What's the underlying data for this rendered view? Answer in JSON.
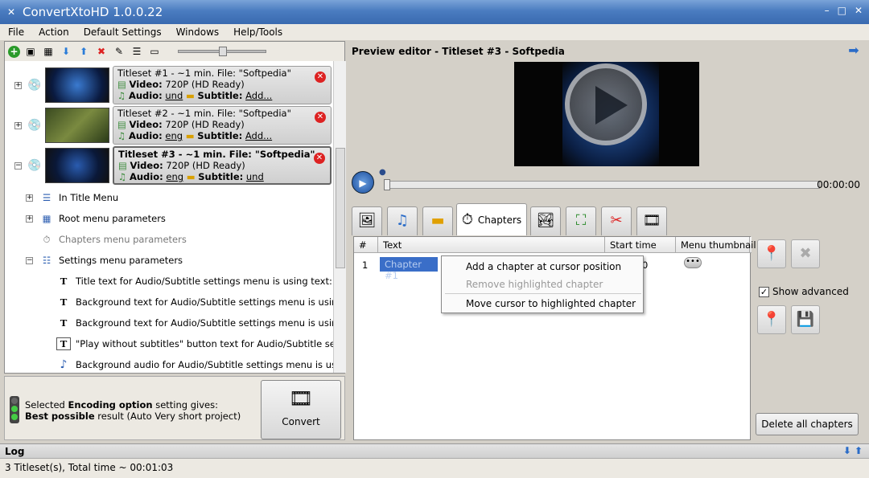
{
  "app": {
    "title": "ConvertXtoHD 1.0.0.22"
  },
  "menu": [
    "File",
    "Action",
    "Default Settings",
    "Windows",
    "Help/Tools"
  ],
  "titlesets": [
    {
      "title": "Titleset #1 - ~1 min. File: \"Softpedia\"",
      "video_label": "Video:",
      "video": "720P (HD Ready)",
      "audio_label": "Audio:",
      "audio": "und",
      "subtitle_label": "Subtitle:",
      "subtitle": "Add..."
    },
    {
      "title": "Titleset #2 - ~1 min. File: \"Softpedia\"",
      "video_label": "Video:",
      "video": "720P (HD Ready)",
      "audio_label": "Audio:",
      "audio": "eng",
      "subtitle_label": "Subtitle:",
      "subtitle": "Add..."
    },
    {
      "title": "Titleset #3 - ~1 min. File: \"Softpedia\"",
      "video_label": "Video:",
      "video": "720P (HD Ready)",
      "audio_label": "Audio:",
      "audio": "eng",
      "subtitle_label": "Subtitle:",
      "subtitle": "und"
    }
  ],
  "tree": {
    "in_title_menu": "In Title Menu",
    "root_menu": "Root menu parameters",
    "chapters_menu": "Chapters menu parameters",
    "settings_menu": "Settings menu parameters",
    "settings_items": [
      "Title text for Audio/Subtitle settings menu is using text: \"Settin...",
      "Background text for Audio/Subtitle settings menu is using text:...",
      "Background text for Audio/Subtitle settings menu is using text:...",
      "\"Play without subtitles\" button text for Audio/Subtitle settings ...",
      "Background audio for Audio/Subtitle settings menu is using def..."
    ]
  },
  "encoding": {
    "line1_prefix": "Selected ",
    "line1_bold": "Encoding option",
    "line1_suffix": " setting gives:",
    "line2_bold": "Best possible",
    "line2_suffix": " result (Auto Very short project)"
  },
  "convert": {
    "label": "Convert"
  },
  "preview": {
    "title": "Preview editor - Titleset #3 - Softpedia",
    "time": "00:00:00"
  },
  "tabs": {
    "active_label": "Chapters"
  },
  "chapters": {
    "columns": [
      "#",
      "Text",
      "Start time",
      "Menu thumbnail"
    ],
    "rows": [
      {
        "num": "1",
        "text": "Chapter #1",
        "start": "0"
      }
    ]
  },
  "context_menu": {
    "items": [
      "Add a chapter at cursor position",
      "Remove highlighted chapter",
      "Move cursor to highlighted chapter"
    ]
  },
  "side": {
    "show_advanced": "Show advanced",
    "delete_all": "Delete all chapters"
  },
  "log": {
    "label": "Log"
  },
  "status": {
    "text": "3 Titleset(s), Total time ~ 00:01:03"
  }
}
